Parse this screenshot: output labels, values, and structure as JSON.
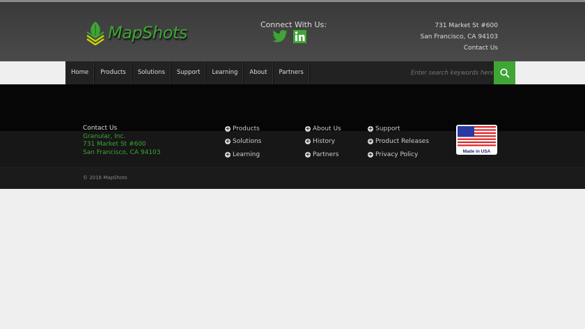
{
  "brand": {
    "name": "MapShots",
    "accent": "#3fa535"
  },
  "header": {
    "connect_label": "Connect With Us:",
    "social": [
      "twitter-icon",
      "linkedin-icon"
    ],
    "address_line1": "731 Market St #600",
    "address_line2": "San Francisco, CA 94103",
    "contact_link": "Contact Us"
  },
  "nav": {
    "items": [
      "Home",
      "Products",
      "Solutions",
      "Support",
      "Learning",
      "About",
      "Partners"
    ],
    "search_placeholder": "Enter search keywords here"
  },
  "footer": {
    "contact_title": "Contact Us",
    "company": "Granular, Inc.",
    "street": "731 Market St #600",
    "city": "San Francisco, CA 94103",
    "col1": [
      "Products",
      "Solutions",
      "Learning"
    ],
    "col2": [
      "About Us",
      "History",
      "Partners"
    ],
    "col3": [
      "Support",
      "Product Releases",
      "Privacy Policy"
    ],
    "badge": "Made in USA",
    "copyright": "© 2016 MapShots"
  }
}
